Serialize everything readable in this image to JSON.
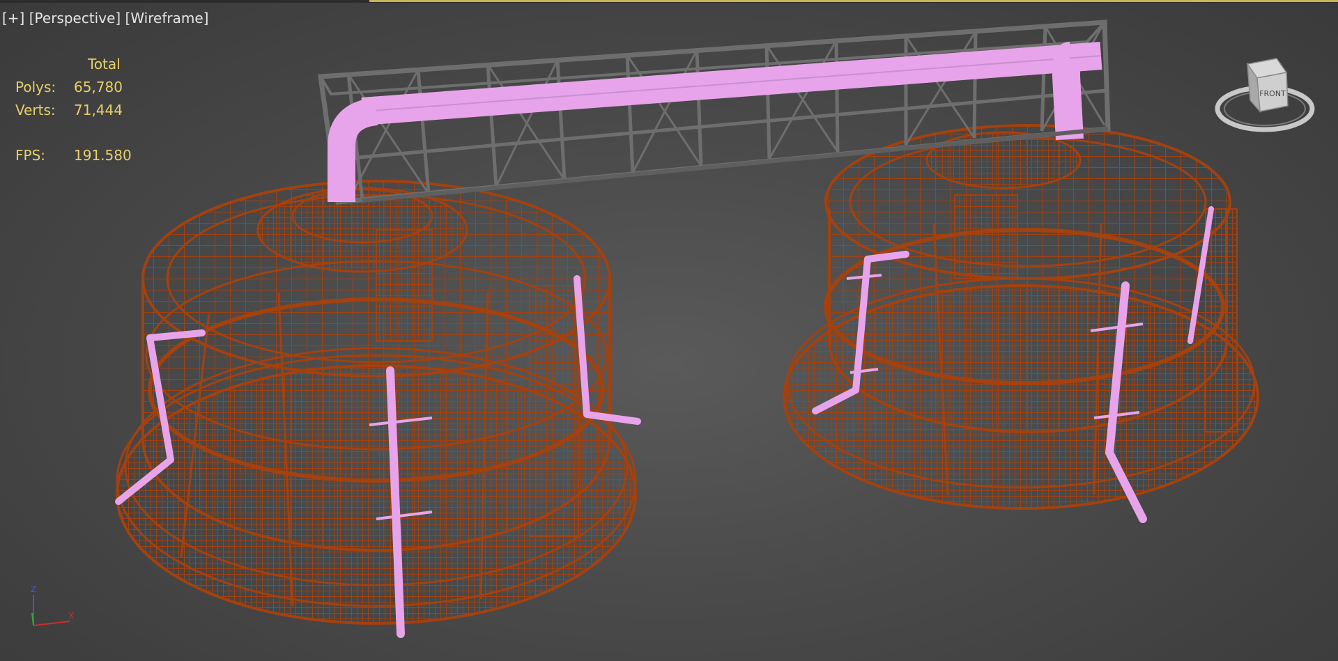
{
  "viewport": {
    "labels": [
      "[+]",
      "[Perspective]",
      "[Wireframe]"
    ],
    "colors": {
      "background": "#4a4a4a",
      "stats_text": "#e8d06a",
      "tank_wire": "#a3410f",
      "pipe": "#e7a4ea",
      "truss": "#6e6e6e"
    }
  },
  "stats": {
    "header": "Total",
    "polys_label": "Polys:",
    "polys_value": "65,780",
    "verts_label": "Verts:",
    "verts_value": "71,444",
    "fps_label": "FPS:",
    "fps_value": "191.580"
  },
  "viewcube": {
    "face_label": "FRONT",
    "icon": "viewcube-icon"
  },
  "axis_gizmo": {
    "z": "Z",
    "x": "X",
    "icon": "axis-tripod-icon"
  }
}
